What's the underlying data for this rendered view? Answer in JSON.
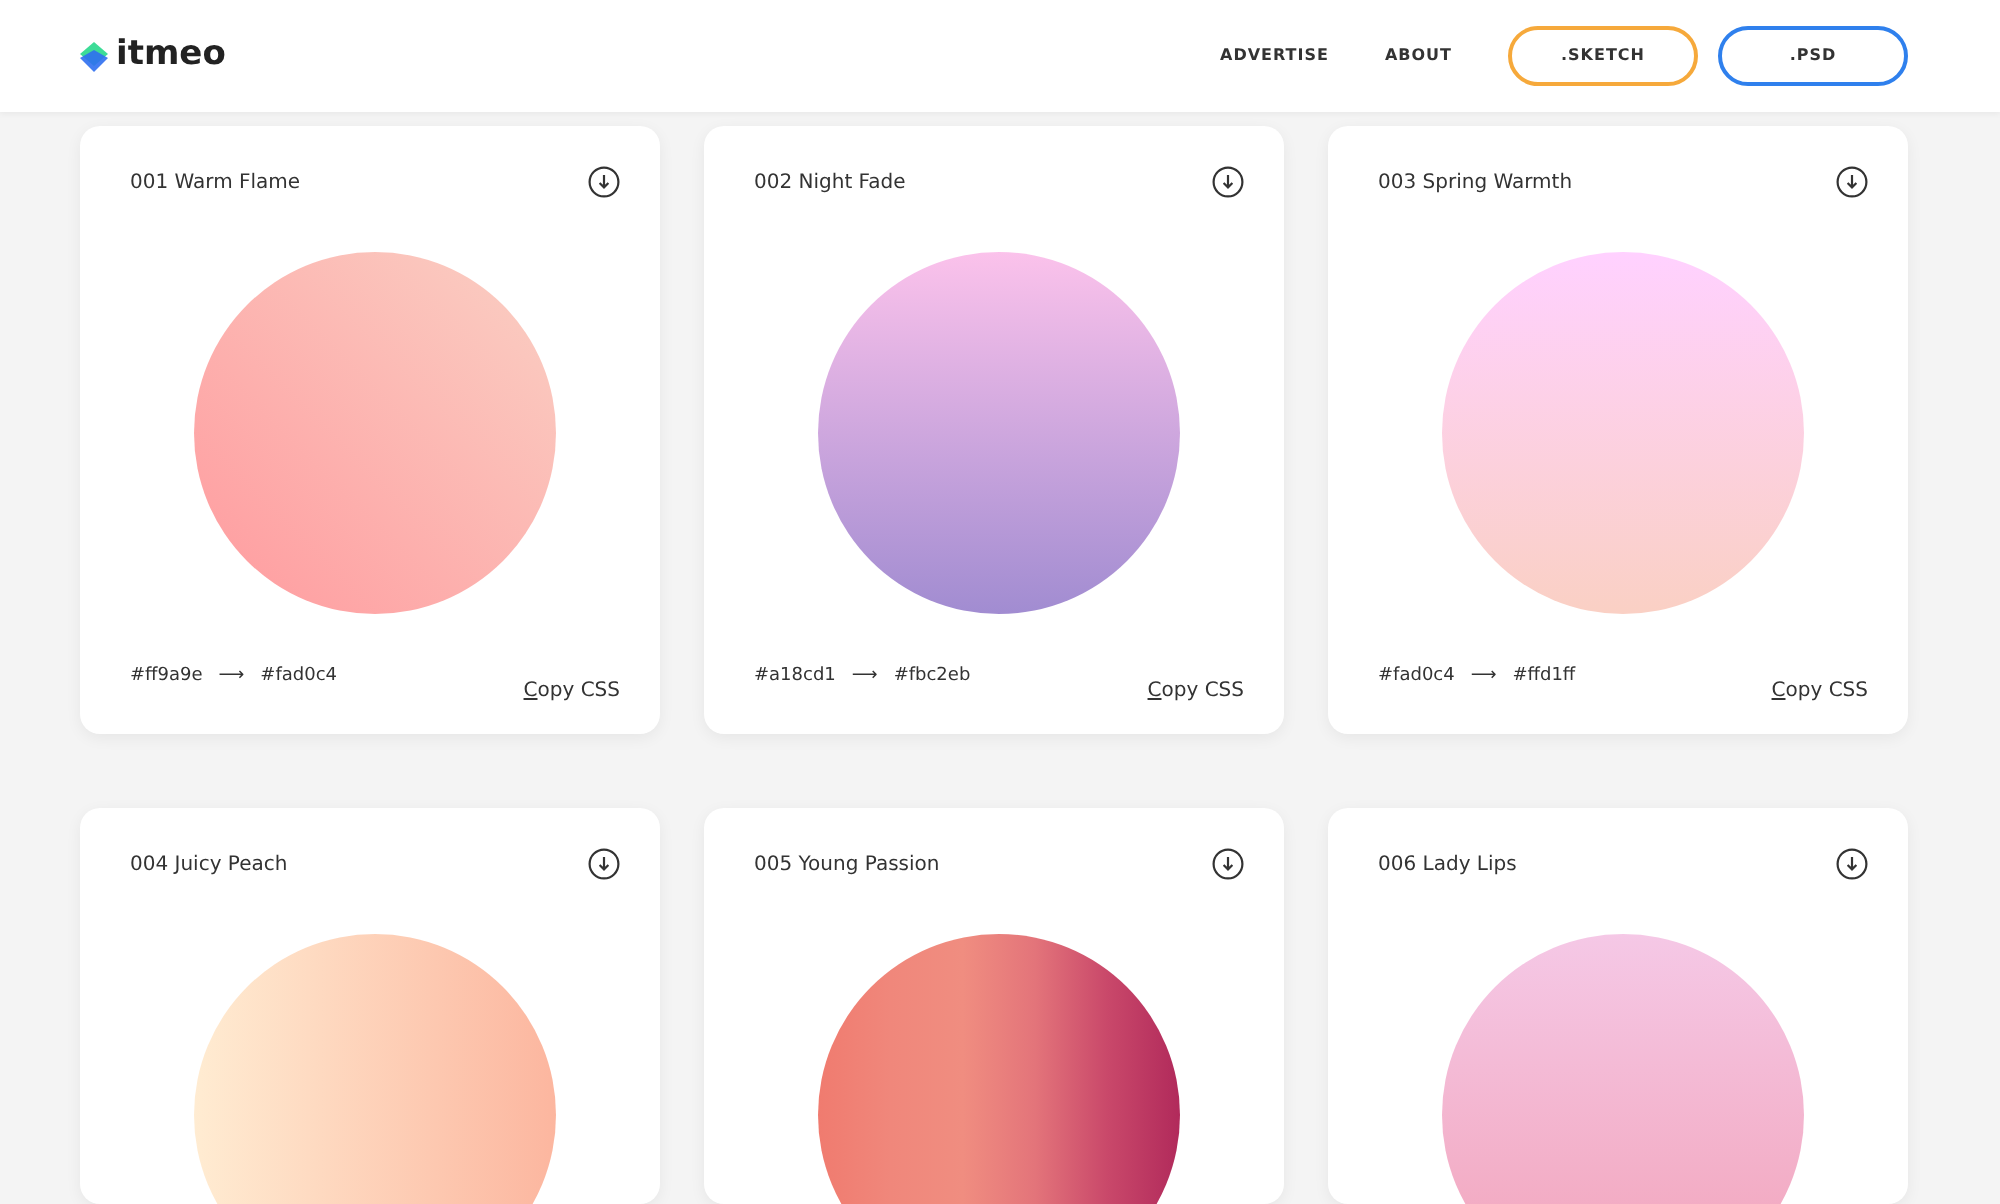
{
  "header": {
    "brand": "itmeo",
    "nav": [
      {
        "label": "ADVERTISE",
        "kind": "link"
      },
      {
        "label": "ABOUT",
        "kind": "link"
      },
      {
        "label": ".SKETCH",
        "kind": "outline",
        "color": "#f6a93b"
      },
      {
        "label": ".PSD",
        "kind": "outline",
        "color": "#2f80ed"
      }
    ]
  },
  "gradients": [
    {
      "title": "001 Warm Flame",
      "kind": "diagonal",
      "stops": [
        {
          "color": "#ff9a9e"
        },
        {
          "color": "#fad0c4"
        }
      ],
      "from": "#ff9a9e",
      "arrow": "⟶",
      "to": "#fad0c4",
      "copy": "Copy CSS"
    },
    {
      "title": "002 Night Fade",
      "kind": "vertical",
      "stops": [
        {
          "color": "#a18cd1"
        },
        {
          "color": "#fbc2eb"
        }
      ],
      "from": "#a18cd1",
      "arrow": "⟶",
      "to": "#fbc2eb",
      "copy": "Copy CSS"
    },
    {
      "title": "003 Spring Warmth",
      "kind": "vertical",
      "stops": [
        {
          "color": "#fad0c4"
        },
        {
          "color": "#ffd1ff"
        }
      ],
      "from": "#fad0c4",
      "arrow": "⟶",
      "to": "#ffd1ff",
      "copy": "Copy CSS"
    },
    {
      "title": "004 Juicy Peach",
      "kind": "horizontal",
      "stops": [
        {
          "color": "#ffecd2"
        },
        {
          "color": "#fcb69f"
        }
      ]
    },
    {
      "title": "005 Young Passion",
      "kind": "horizontal",
      "stops": [
        {
          "color": "#f07b6f"
        },
        {
          "color": "#f0877b"
        },
        {
          "color": "#f08d80"
        },
        {
          "color": "#e3747a"
        },
        {
          "color": "#c9486a"
        },
        {
          "color": "#b12a5b"
        }
      ]
    },
    {
      "title": "006 Lady Lips",
      "kind": "vertical",
      "stops": [
        {
          "color": "#f2a3b9"
        },
        {
          "color": "#f5c8e6"
        }
      ]
    }
  ]
}
